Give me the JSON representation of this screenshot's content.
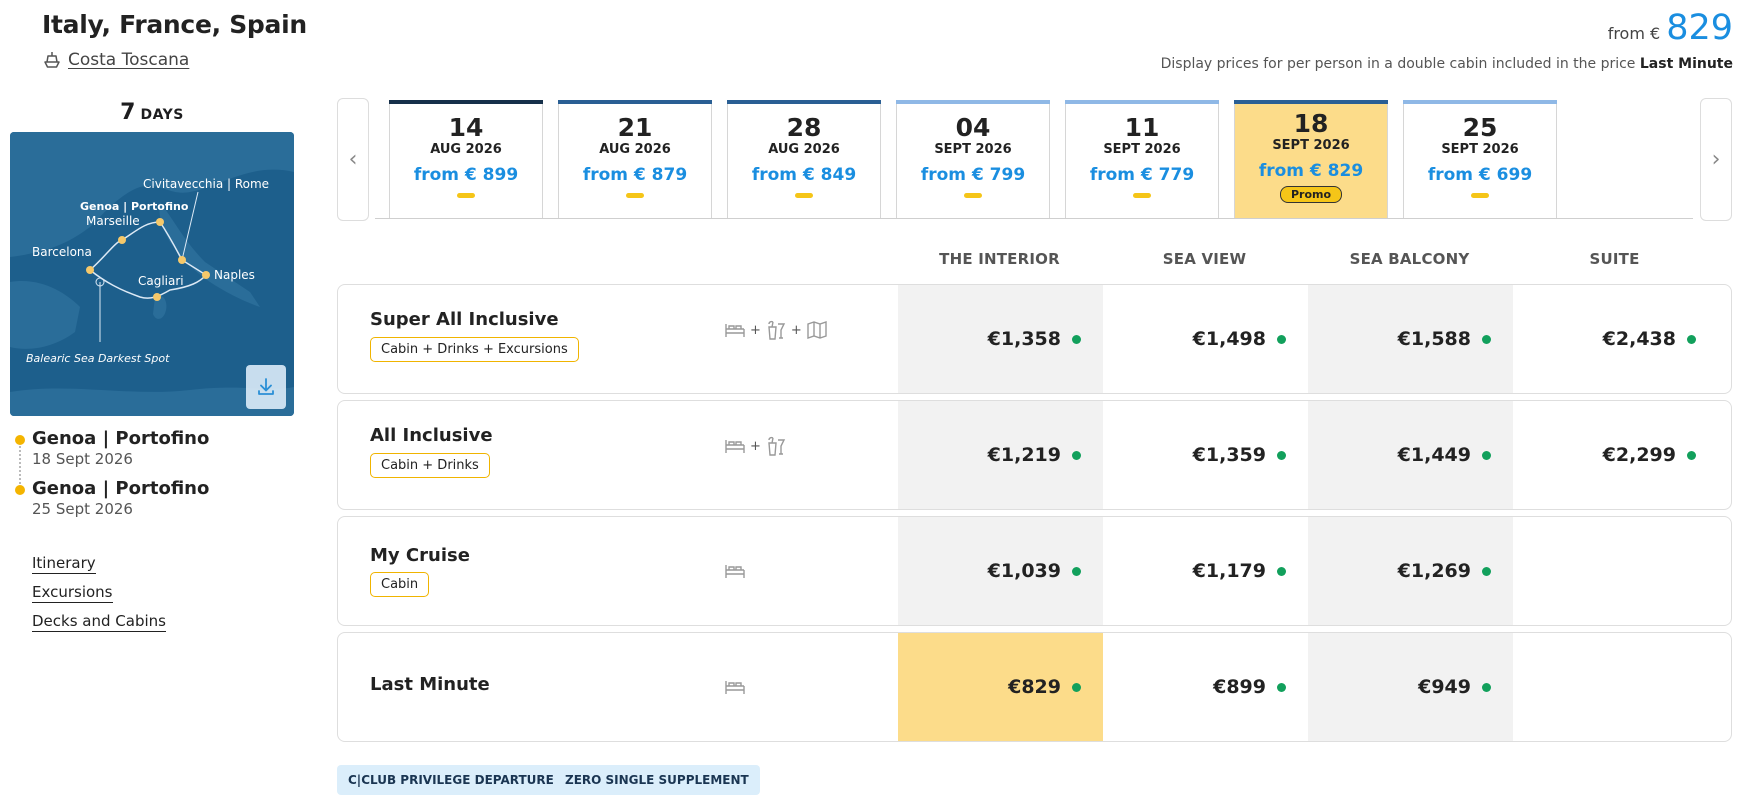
{
  "header": {
    "title": "Italy, France, Spain",
    "ship_name": "Costa Toscana"
  },
  "summary": {
    "from_label": "from €",
    "from_price": "829",
    "disclaimer_text": "Display prices for per person in a double cabin included in the price",
    "disclaimer_bold": "Last Minute"
  },
  "duration": {
    "number": "7",
    "label": "DAYS"
  },
  "map": {
    "ports": [
      "Civitavecchia | Rome",
      "Genoa | Portofino",
      "Marseille",
      "Barcelona",
      "Cagliari",
      "Naples"
    ],
    "annotation": "Balearic Sea Darkest Spot"
  },
  "itinerary": {
    "stops": [
      {
        "name": "Genoa | Portofino",
        "date": "18 Sept 2026"
      },
      {
        "name": "Genoa | Portofino",
        "date": "25 Sept 2026"
      }
    ]
  },
  "nav_links": [
    "Itinerary",
    "Excursions",
    "Decks and Cabins"
  ],
  "carousel": {
    "prev_icon": "chevron-left-icon",
    "next_icon": "chevron-right-icon",
    "dates": [
      {
        "day": "14",
        "month": "AUG 2026",
        "from": "from € 899",
        "bar_color": "#16304a",
        "active": false
      },
      {
        "day": "21",
        "month": "AUG 2026",
        "from": "from € 879",
        "bar_color": "#2a5f94",
        "active": false
      },
      {
        "day": "28",
        "month": "AUG 2026",
        "from": "from € 849",
        "bar_color": "#2a5f94",
        "active": false
      },
      {
        "day": "04",
        "month": "SEPT 2026",
        "from": "from € 799",
        "bar_color": "#8fb8e6",
        "active": false
      },
      {
        "day": "11",
        "month": "SEPT 2026",
        "from": "from € 779",
        "bar_color": "#8fb8e6",
        "active": false
      },
      {
        "day": "18",
        "month": "SEPT 2026",
        "from": "from € 829",
        "bar_color": "#2a5f94",
        "active": true,
        "badge": "Promo"
      },
      {
        "day": "25",
        "month": "SEPT 2026",
        "from": "from € 699",
        "bar_color": "#8fb8e6",
        "active": false
      }
    ]
  },
  "pricing": {
    "columns": [
      "THE INTERIOR",
      "SEA VIEW",
      "SEA BALCONY",
      "SUITE"
    ],
    "rows": [
      {
        "name": "Super All Inclusive",
        "chip": "Cabin + Drinks + Excursions",
        "icons": [
          "bed-icon",
          "drinks-icon",
          "map-icon"
        ],
        "prices": [
          "€1,358",
          "€1,498",
          "€1,588",
          "€2,438"
        ]
      },
      {
        "name": "All Inclusive",
        "chip": "Cabin + Drinks",
        "icons": [
          "bed-icon",
          "drinks-icon"
        ],
        "prices": [
          "€1,219",
          "€1,359",
          "€1,449",
          "€2,299"
        ]
      },
      {
        "name": "My Cruise",
        "chip": "Cabin",
        "icons": [
          "bed-icon"
        ],
        "prices": [
          "€1,039",
          "€1,179",
          "€1,269",
          ""
        ]
      },
      {
        "name": "Last Minute",
        "chip": "",
        "icons": [
          "bed-icon"
        ],
        "prices": [
          "€829",
          "€899",
          "€949",
          ""
        ],
        "highlight_column": 0
      }
    ]
  },
  "tags": [
    "C|CLUB PRIVILEGE DEPARTURES",
    "ZERO SINGLE SUPPLEMENT"
  ],
  "colors": {
    "accent_blue": "#1a8ee0",
    "highlight_yellow": "#fcdc8a",
    "chip_border": "#f0b400",
    "available_green": "#12a05c",
    "map_sea": "#1d5f8c"
  }
}
